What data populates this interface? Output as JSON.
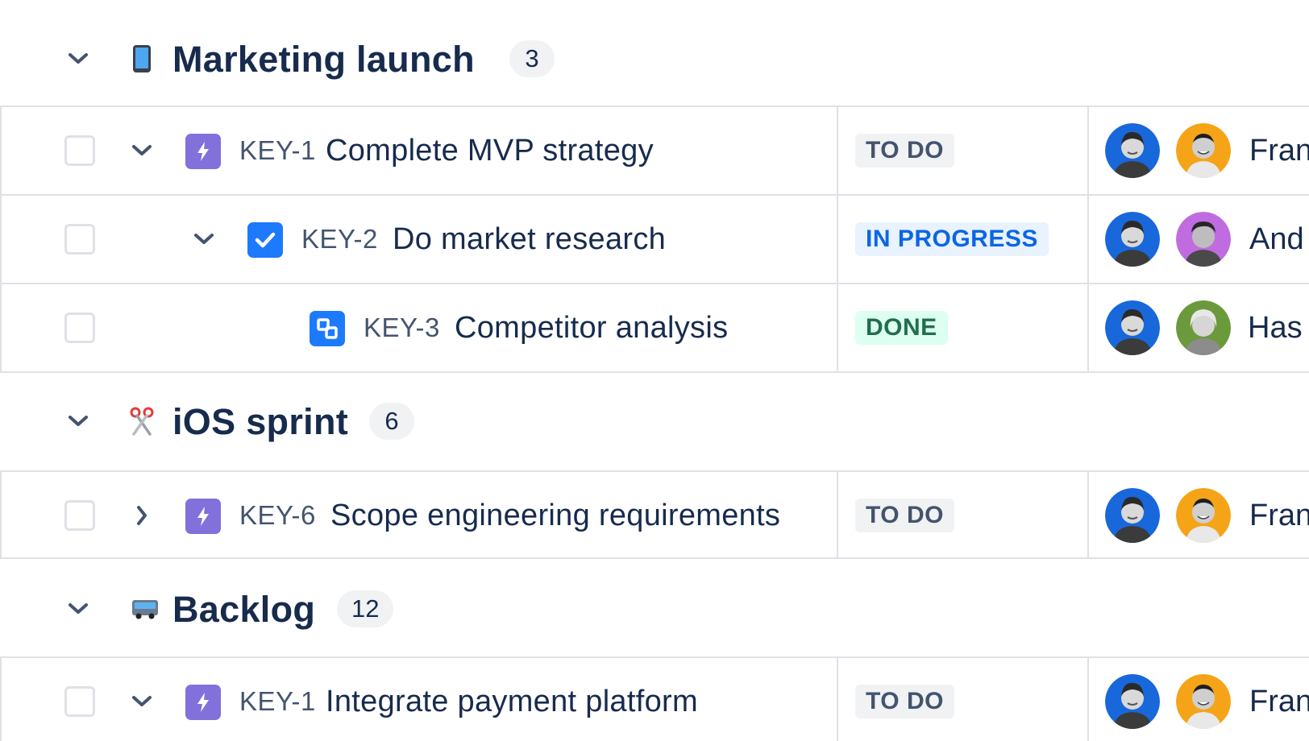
{
  "groups": [
    {
      "title": "Marketing launch",
      "count": "3",
      "icon": "mobile-phone-icon",
      "issues": [
        {
          "key": "KEY-1",
          "summary": "Complete MVP strategy",
          "type": "epic-icon",
          "status": "TO DO",
          "assignee": "Fran",
          "chevron": "chevron-down-icon"
        },
        {
          "key": "KEY-2",
          "summary": "Do market research",
          "type": "task-checkbox-icon",
          "status": "IN PROGRESS",
          "assignee": "And",
          "chevron": "chevron-down-icon"
        },
        {
          "key": "KEY-3",
          "summary": "Competitor analysis",
          "type": "subtask-icon",
          "status": "DONE",
          "assignee": "Has"
        }
      ]
    },
    {
      "title": "iOS sprint",
      "count": "6",
      "icon": "scissors-icon",
      "issues": [
        {
          "key": "KEY-6",
          "summary": "Scope engineering requirements",
          "type": "epic-icon",
          "status": "TO DO",
          "assignee": "Fran",
          "chevron": "chevron-right-icon"
        }
      ]
    },
    {
      "title": "Backlog",
      "count": "12",
      "icon": "bus-icon",
      "issues": [
        {
          "key": "KEY-1",
          "summary": "Integrate payment platform",
          "type": "epic-icon",
          "status": "TO DO",
          "assignee": "Fran",
          "chevron": "chevron-down-icon"
        }
      ]
    }
  ],
  "colors": {
    "epic_purple": "#8270db",
    "task_blue": "#1d7afc",
    "todo_bg": "#f1f2f4",
    "progress_bg": "#e9f2ff",
    "done_bg": "#dcfff1"
  }
}
